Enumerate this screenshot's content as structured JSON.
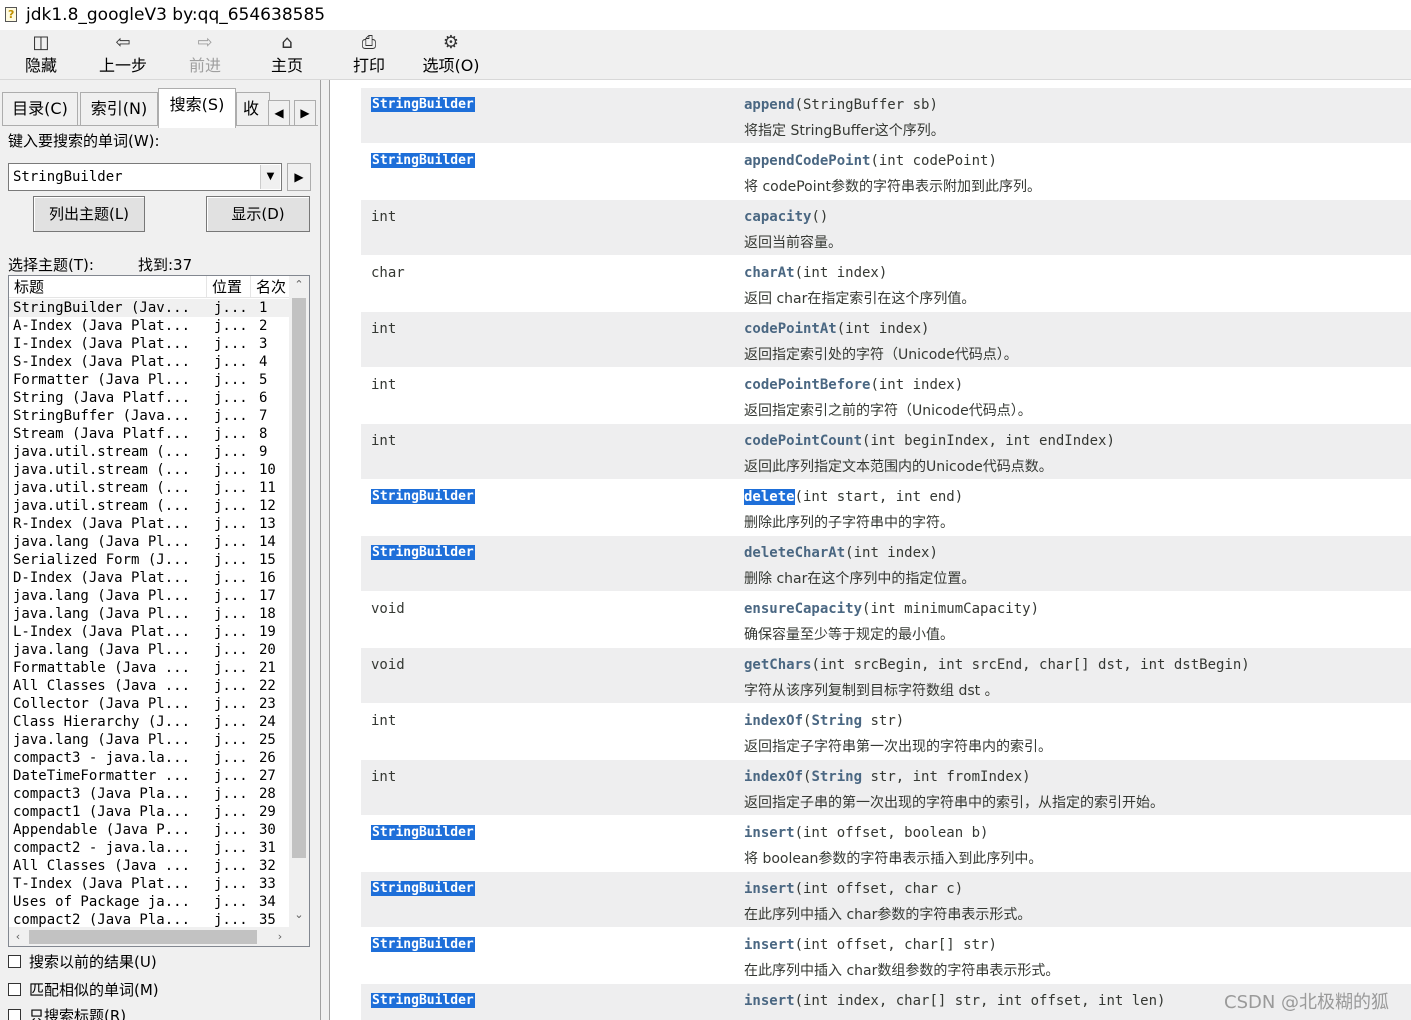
{
  "window": {
    "title": "jdk1.8_googleV3 by:qq_654638585",
    "icon": "chm-help-icon"
  },
  "toolbar": [
    {
      "label": "隐藏",
      "icon": "hide-pane-icon",
      "enabled": true
    },
    {
      "label": "上一步",
      "icon": "back-arrow-icon",
      "enabled": true
    },
    {
      "label": "前进",
      "icon": "forward-arrow-icon",
      "enabled": false
    },
    {
      "label": "主页",
      "icon": "home-icon",
      "enabled": true
    },
    {
      "label": "打印",
      "icon": "print-icon",
      "enabled": true
    },
    {
      "label": "选项(O)",
      "icon": "options-icon",
      "enabled": true
    }
  ],
  "tabs": {
    "contents": "目录(C)",
    "index": "索引(N)",
    "search": "搜索(S)",
    "favorites": "收藏"
  },
  "search": {
    "prompt": "键入要搜索的单词(W):",
    "value": "StringBuilder",
    "list_topics_button": "列出主题(L)",
    "display_button": "显示(D)",
    "select_topic_label": "选择主题(T):",
    "found_label": "找到:37"
  },
  "results": {
    "headers": [
      "标题",
      "位置",
      "名次"
    ],
    "rows": [
      [
        "StringBuilder (Jav...",
        "j...",
        "1"
      ],
      [
        "A-Index (Java Plat...",
        "j...",
        "2"
      ],
      [
        "I-Index (Java Plat...",
        "j...",
        "3"
      ],
      [
        "S-Index (Java Plat...",
        "j...",
        "4"
      ],
      [
        "Formatter (Java Pl...",
        "j...",
        "5"
      ],
      [
        "String (Java Platf...",
        "j...",
        "6"
      ],
      [
        "StringBuffer (Java...",
        "j...",
        "7"
      ],
      [
        "Stream (Java Platf...",
        "j...",
        "8"
      ],
      [
        "java.util.stream (...",
        "j...",
        "9"
      ],
      [
        "java.util.stream (...",
        "j...",
        "10"
      ],
      [
        "java.util.stream (...",
        "j...",
        "11"
      ],
      [
        "java.util.stream (...",
        "j...",
        "12"
      ],
      [
        "R-Index (Java Plat...",
        "j...",
        "13"
      ],
      [
        "java.lang (Java Pl...",
        "j...",
        "14"
      ],
      [
        "Serialized Form (J...",
        "j...",
        "15"
      ],
      [
        "D-Index (Java Plat...",
        "j...",
        "16"
      ],
      [
        "java.lang (Java Pl...",
        "j...",
        "17"
      ],
      [
        "java.lang (Java Pl...",
        "j...",
        "18"
      ],
      [
        "L-Index (Java Plat...",
        "j...",
        "19"
      ],
      [
        "java.lang (Java Pl...",
        "j...",
        "20"
      ],
      [
        "Formattable (Java ...",
        "j...",
        "21"
      ],
      [
        "All Classes (Java ...",
        "j...",
        "22"
      ],
      [
        "Collector (Java Pl...",
        "j...",
        "23"
      ],
      [
        "Class Hierarchy (J...",
        "j...",
        "24"
      ],
      [
        "java.lang (Java Pl...",
        "j...",
        "25"
      ],
      [
        "compact3 - java.la...",
        "j...",
        "26"
      ],
      [
        "DateTimeFormatter ...",
        "j...",
        "27"
      ],
      [
        "compact3 (Java Pla...",
        "j...",
        "28"
      ],
      [
        "compact1 (Java Pla...",
        "j...",
        "29"
      ],
      [
        "Appendable (Java P...",
        "j...",
        "30"
      ],
      [
        "compact2 - java.la...",
        "j...",
        "31"
      ],
      [
        "All Classes (Java ...",
        "j...",
        "32"
      ],
      [
        "T-Index (Java Plat...",
        "j...",
        "33"
      ],
      [
        "Uses of Package ja...",
        "j...",
        "34"
      ],
      [
        "compact2 (Java Pla...",
        "j...",
        "35"
      ]
    ]
  },
  "options": {
    "search_previous": "搜索以前的结果(U)",
    "match_similar": "匹配相似的单词(M)",
    "titles_only": "只搜索标题(R)"
  },
  "methods": [
    {
      "type": "StringBuilder",
      "type_hl": true,
      "name": "append",
      "name_hl": false,
      "params": "(StringBuffer sb)",
      "desc": "将指定 StringBuffer这个序列。"
    },
    {
      "type": "StringBuilder",
      "type_hl": true,
      "name": "appendCodePoint",
      "name_hl": false,
      "params": "(int codePoint)",
      "desc": "将 codePoint参数的字符串表示附加到此序列。"
    },
    {
      "type": "int",
      "type_hl": false,
      "name": "capacity",
      "name_hl": false,
      "params": "()",
      "desc": "返回当前容量。"
    },
    {
      "type": "char",
      "type_hl": false,
      "name": "charAt",
      "name_hl": false,
      "params": "(int index)",
      "desc": "返回 char在指定索引在这个序列值。"
    },
    {
      "type": "int",
      "type_hl": false,
      "name": "codePointAt",
      "name_hl": false,
      "params": "(int index)",
      "desc": "返回指定索引处的字符（Unicode代码点）。"
    },
    {
      "type": "int",
      "type_hl": false,
      "name": "codePointBefore",
      "name_hl": false,
      "params": "(int index)",
      "desc": "返回指定索引之前的字符（Unicode代码点）。"
    },
    {
      "type": "int",
      "type_hl": false,
      "name": "codePointCount",
      "name_hl": false,
      "params": "(int beginIndex, int endIndex)",
      "desc": "返回此序列指定文本范围内的Unicode代码点数。"
    },
    {
      "type": "StringBuilder",
      "type_hl": true,
      "name": "delete",
      "name_hl": true,
      "params": "(int start, int end)",
      "desc": "删除此序列的子字符串中的字符。"
    },
    {
      "type": "StringBuilder",
      "type_hl": true,
      "name": "deleteCharAt",
      "name_hl": false,
      "params": "(int index)",
      "desc": "删除 char在这个序列中的指定位置。"
    },
    {
      "type": "void",
      "type_hl": false,
      "name": "ensureCapacity",
      "name_hl": false,
      "params": "(int minimumCapacity)",
      "desc": "确保容量至少等于规定的最小值。"
    },
    {
      "type": "void",
      "type_hl": false,
      "name": "getChars",
      "name_hl": false,
      "params": "(int srcBegin, int srcEnd, char[] dst, int dstBegin)",
      "desc": "字符从该序列复制到目标字符数组 dst 。"
    },
    {
      "type": "int",
      "type_hl": false,
      "name": "indexOf",
      "name_hl": false,
      "params_pre": "(",
      "ptype": "String",
      "params": " str)",
      "desc": "返回指定子字符串第一次出现的字符串内的索引。"
    },
    {
      "type": "int",
      "type_hl": false,
      "name": "indexOf",
      "name_hl": false,
      "params_pre": "(",
      "ptype": "String",
      "params": " str, int fromIndex)",
      "desc": "返回指定子串的第一次出现的字符串中的索引，从指定的索引开始。"
    },
    {
      "type": "StringBuilder",
      "type_hl": true,
      "name": "insert",
      "name_hl": false,
      "params": "(int offset, boolean b)",
      "desc": "将 boolean参数的字符串表示插入到此序列中。"
    },
    {
      "type": "StringBuilder",
      "type_hl": true,
      "name": "insert",
      "name_hl": false,
      "params": "(int offset, char c)",
      "desc": "在此序列中插入 char参数的字符串表示形式。"
    },
    {
      "type": "StringBuilder",
      "type_hl": true,
      "name": "insert",
      "name_hl": false,
      "params": "(int offset, char[] str)",
      "desc": "在此序列中插入 char数组参数的字符串表示形式。"
    },
    {
      "type": "StringBuilder",
      "type_hl": true,
      "name": "insert",
      "name_hl": false,
      "params": "(int index, char[] str, int offset, int len)",
      "desc": ""
    }
  ],
  "watermark": "CSDN @北极糊的狐",
  "colors": {
    "highlight": "#1e6fd9",
    "method_name": "#4a6782",
    "alt_row": "#eeeeef"
  }
}
